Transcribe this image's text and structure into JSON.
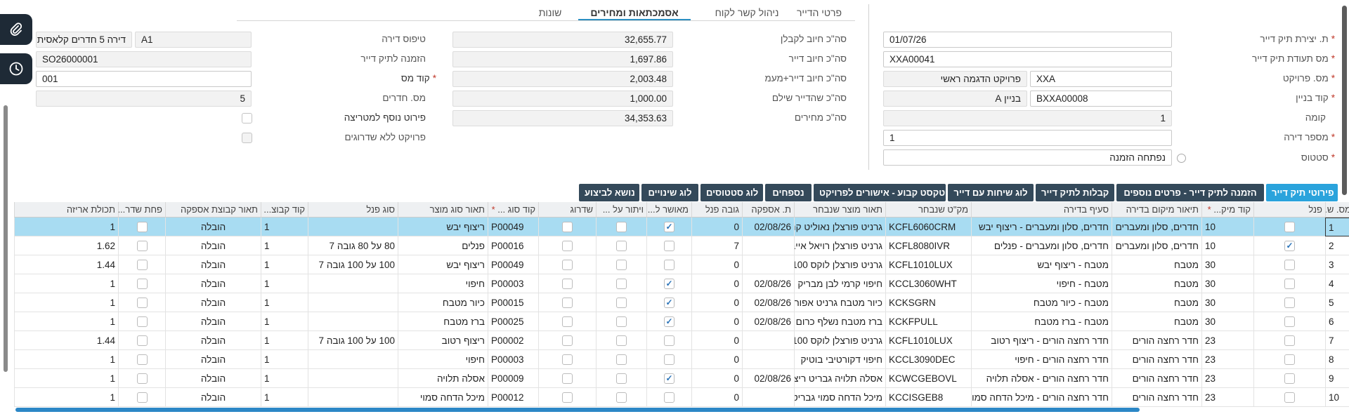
{
  "tabs": [
    {
      "label": "פרטי הדייר"
    },
    {
      "label": "ניהול קשר לקוח"
    },
    {
      "label": "אסמכתאות ומחירים"
    },
    {
      "label": "שונות"
    }
  ],
  "right_form": {
    "creation_date": {
      "label": "ת. יצירת תיק דייר",
      "value": "01/07/26"
    },
    "tenant_cert": {
      "label": "מס תעודת תיק דייר",
      "value": "XXA00041"
    },
    "project": {
      "label": "מס. פרויקט",
      "value": "XXA",
      "desc": "פרויקט הדגמה ראשי"
    },
    "building": {
      "label": "קוד בניין",
      "value": "BXXA00008",
      "desc": "בניין A"
    },
    "floor": {
      "label": "קומה",
      "value": "1"
    },
    "apartment_no": {
      "label": "מספר דירה",
      "value": "1"
    },
    "status": {
      "label": "סטטוס",
      "value": "נפתחה הזמנה"
    }
  },
  "middle_form": {
    "contractor_total": {
      "label": "סה\"כ חיוב לקבלן",
      "value": "32,655.77"
    },
    "tenant_total": {
      "label": "סה\"כ חיוב דייר",
      "value": "1,697.86"
    },
    "tenant_vat_total": {
      "label": "סה\"כ חיוב דייר+מעמ",
      "value": "2,003.48"
    },
    "tenant_paid": {
      "label": "סה\"כ שהדייר שילם",
      "value": "1,000.00"
    },
    "prices_total": {
      "label": "סה\"כ מחירים",
      "value": "34,353.63"
    }
  },
  "left_form": {
    "apt_type": {
      "label": "טיפוס דירה",
      "value": "A1",
      "desc": "דירה 5 חדרים קלאסית"
    },
    "order": {
      "label": "הזמנה לתיק דייר",
      "value": "SO26000001"
    },
    "tax_code": {
      "label": "קוד מס",
      "value": "001"
    },
    "rooms": {
      "label": "מס. חדרים",
      "value": "5"
    },
    "extra_matrix": {
      "label": "פירוט נוסף למטריצה"
    },
    "no_upgrades": {
      "label": "פרויקט ללא שדרוגים"
    }
  },
  "grid_buttons": [
    {
      "label": "פירוטי תיק דייר"
    },
    {
      "label": "הזמנה לתיק דייר - פרטים נוספים"
    },
    {
      "label": "קבלות לתיק דייר"
    },
    {
      "label": "לוג שיחות עם דייר"
    },
    {
      "label": "טקסט קבוע - אישורים לפרויקט"
    },
    {
      "label": "נספחים"
    },
    {
      "label": "לוג סטטוסים"
    },
    {
      "label": "לוג שינויים"
    },
    {
      "label": "נושא לביצוע"
    }
  ],
  "columns": [
    {
      "label": "מס. ש..."
    },
    {
      "label": "פנל"
    },
    {
      "label": "קוד מיק...",
      "required": true
    },
    {
      "label": "תיאור מיקום בדירה"
    },
    {
      "label": "סעיף בדירה"
    },
    {
      "label": "מק\"ט שנבחר"
    },
    {
      "label": "תאור מוצר שנבחר"
    },
    {
      "label": "ת. אספקה"
    },
    {
      "label": "גובה פנל"
    },
    {
      "label": "מאושר ל..."
    },
    {
      "label": "ויתור על ..."
    },
    {
      "label": "שדרוג"
    },
    {
      "label": "קוד סוג ...",
      "required": true
    },
    {
      "label": "תאור סוג מוצר"
    },
    {
      "label": "סוג פנל"
    },
    {
      "label": "קוד קבוצ..."
    },
    {
      "label": "תאור קבוצת אספקה"
    },
    {
      "label": "פחת שדר..."
    },
    {
      "label": "תכולת אריזה"
    }
  ],
  "rows": [
    {
      "num": "1",
      "panel": false,
      "loc_code": "10",
      "loc_desc": "חדרים, סלון ומעברים",
      "section": "חדרים, סלון ומעברים - ריצוף יבש",
      "sku": "KCFL6060CRM",
      "prod_desc": "גרניט פורצלן נאוליט קר",
      "supply_date": "02/08/26",
      "panel_height": "0",
      "approved": true,
      "waiver": false,
      "upgrade": false,
      "type_code": "P00049",
      "type_desc": "ריצוף יבש",
      "panel_type": "",
      "group_code": "1",
      "group_desc": "הובלה",
      "upgrade_waste": false,
      "pack": "1"
    },
    {
      "num": "2",
      "panel": true,
      "loc_code": "10",
      "loc_desc": "חדרים, סלון ומעברים",
      "section": "חדרים, סלון ומעברים - פנלים",
      "sku": "KCFL8080IVR",
      "prod_desc": "גרניט פורצלן רויאל אייב",
      "supply_date": "",
      "panel_height": "7",
      "approved": false,
      "waiver": false,
      "upgrade": false,
      "type_code": "P00016",
      "type_desc": "פנלים",
      "panel_type": "80 על 80 גובה 7",
      "group_code": "1",
      "group_desc": "הובלה",
      "upgrade_waste": false,
      "pack": "1.62"
    },
    {
      "num": "3",
      "panel": false,
      "loc_code": "30",
      "loc_desc": "מטבח",
      "section": "מטבח - ריצוף יבש",
      "sku": "KCFL1010LUX",
      "prod_desc": "גרניט פורצלן לוקס 100",
      "supply_date": "",
      "panel_height": "0",
      "approved": false,
      "waiver": false,
      "upgrade": false,
      "type_code": "P00049",
      "type_desc": "ריצוף יבש",
      "panel_type": "100 על 100 גובה 7",
      "group_code": "1",
      "group_desc": "הובלה",
      "upgrade_waste": false,
      "pack": "1.44"
    },
    {
      "num": "4",
      "panel": false,
      "loc_code": "30",
      "loc_desc": "מטבח",
      "section": "מטבח - חיפוי",
      "sku": "KCCL3060WHT",
      "prod_desc": "חיפוי קרמי לבן מבריק",
      "supply_date": "02/08/26",
      "panel_height": "0",
      "approved": true,
      "waiver": false,
      "upgrade": false,
      "type_code": "P00003",
      "type_desc": "חיפוי",
      "panel_type": "",
      "group_code": "1",
      "group_desc": "הובלה",
      "upgrade_waste": false,
      "pack": "1"
    },
    {
      "num": "5",
      "panel": false,
      "loc_code": "30",
      "loc_desc": "מטבח",
      "section": "מטבח - כיור מטבח",
      "sku": "KCKSGRN",
      "prod_desc": "כיור מטבח גרניט אפור",
      "supply_date": "02/08/26",
      "panel_height": "0",
      "approved": true,
      "waiver": false,
      "upgrade": false,
      "type_code": "P00015",
      "type_desc": "כיור מטבח",
      "panel_type": "",
      "group_code": "1",
      "group_desc": "הובלה",
      "upgrade_waste": false,
      "pack": "1"
    },
    {
      "num": "6",
      "panel": false,
      "loc_code": "30",
      "loc_desc": "מטבח",
      "section": "מטבח - ברז מטבח",
      "sku": "KCKFPULL",
      "prod_desc": "ברז מטבח נשלף כרום",
      "supply_date": "02/08/26",
      "panel_height": "0",
      "approved": true,
      "waiver": false,
      "upgrade": false,
      "type_code": "P00025",
      "type_desc": "ברז מטבח",
      "panel_type": "",
      "group_code": "1",
      "group_desc": "הובלה",
      "upgrade_waste": false,
      "pack": "1"
    },
    {
      "num": "7",
      "panel": false,
      "loc_code": "23",
      "loc_desc": "חדר רחצה הורים",
      "section": "חדר רחצה הורים - ריצוף רטוב",
      "sku": "KCFL1010LUX",
      "prod_desc": "גרניט פורצלן לוקס 100",
      "supply_date": "",
      "panel_height": "0",
      "approved": false,
      "waiver": false,
      "upgrade": false,
      "type_code": "P00002",
      "type_desc": "ריצוף רטוב",
      "panel_type": "100 על 100 גובה 7",
      "group_code": "1",
      "group_desc": "הובלה",
      "upgrade_waste": false,
      "pack": "1.44"
    },
    {
      "num": "8",
      "panel": false,
      "loc_code": "23",
      "loc_desc": "חדר רחצה הורים",
      "section": "חדר רחצה הורים - חיפוי",
      "sku": "KCCL3090DEC",
      "prod_desc": "חיפוי דקורטיבי בוטיק",
      "supply_date": "",
      "panel_height": "0",
      "approved": false,
      "waiver": false,
      "upgrade": false,
      "type_code": "P00003",
      "type_desc": "חיפוי",
      "panel_type": "",
      "group_code": "1",
      "group_desc": "הובלה",
      "upgrade_waste": false,
      "pack": "1"
    },
    {
      "num": "9",
      "panel": false,
      "loc_code": "23",
      "loc_desc": "חדר רחצה הורים",
      "section": "חדר רחצה הורים - אסלה תלויה",
      "sku": "KCWCGEBOVL",
      "prod_desc": "אסלה תלויה גבריט ריצ",
      "supply_date": "02/08/26",
      "panel_height": "0",
      "approved": true,
      "waiver": false,
      "upgrade": false,
      "type_code": "P00009",
      "type_desc": "אסלה תלויה",
      "panel_type": "",
      "group_code": "1",
      "group_desc": "הובלה",
      "upgrade_waste": false,
      "pack": "1"
    },
    {
      "num": "10",
      "panel": false,
      "loc_code": "23",
      "loc_desc": "חדר רחצה הורים",
      "section": "חדר רחצה הורים - מיכל הדחה סמוי",
      "sku": "KCCISGEB8",
      "prod_desc": "מיכל הדחה סמוי גבריט",
      "supply_date": "",
      "panel_height": "0",
      "approved": false,
      "waiver": false,
      "upgrade": false,
      "type_code": "P00012",
      "type_desc": "מיכל הדחה סמוי",
      "panel_type": "",
      "group_code": "1",
      "group_desc": "הובלה",
      "upgrade_waste": false,
      "pack": "1"
    }
  ],
  "icons": {
    "attach": "paperclip-icon",
    "history": "clock-icon"
  },
  "colors": {
    "sidebar": "#1e2a36",
    "active_tab": "#2b8fc2",
    "button": "#34495a",
    "button_active": "#2aa3dc",
    "selected_row": "#a8dcf2",
    "required": "#c0392b"
  }
}
